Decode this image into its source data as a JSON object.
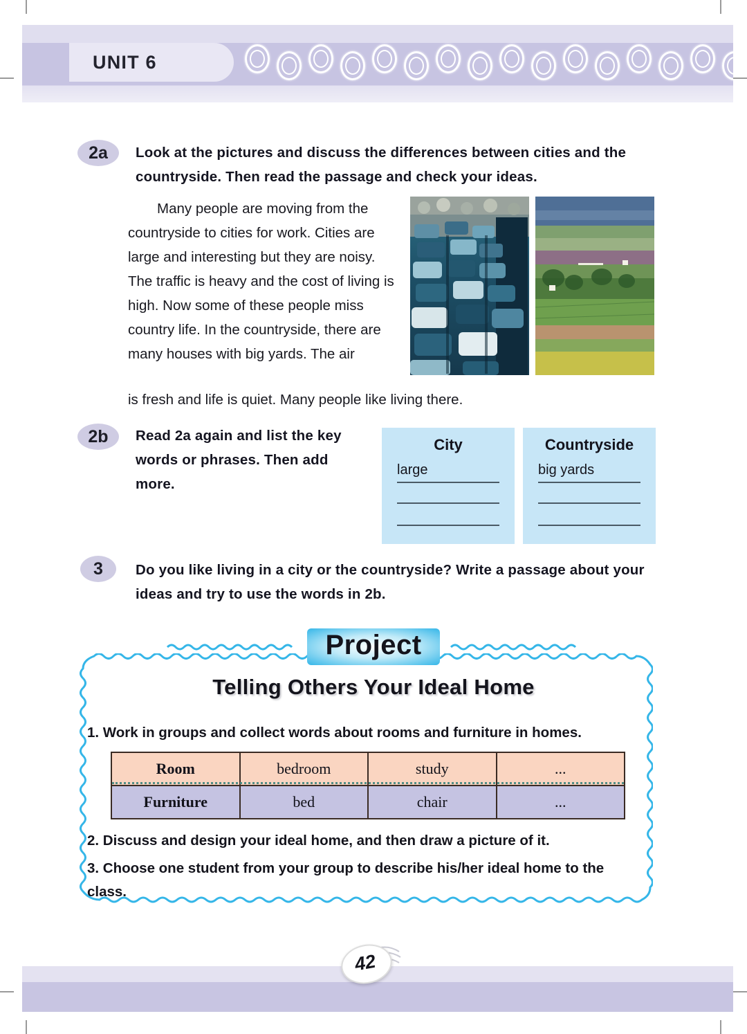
{
  "header": {
    "unit_label": "UNIT 6",
    "ring_count": 16,
    "band_color": "#c7c4e2",
    "tab_color": "#e9e7f4"
  },
  "sections": {
    "two_a": {
      "badge": "2a",
      "instruction": "Look at the pictures and discuss the differences between cities and the countryside. Then read the passage and check your ideas.",
      "passage": "Many people are moving from the countryside to cities for work. Cities are large and interesting but they are noisy. The traffic is heavy and the cost of living is high. Now some of these people miss country life. In the countryside, there are many houses with big yards. The air",
      "passage_last_line": "is fresh and life is quiet. Many people like living there.",
      "images": [
        {
          "name": "city-traffic-photo",
          "alt": "Heavy traffic jam with many cars on a city road"
        },
        {
          "name": "countryside-photo",
          "alt": "Green countryside fields and farmland"
        }
      ]
    },
    "two_b": {
      "badge": "2b",
      "instruction": "Read 2a again and list the key words or phrases. Then add more.",
      "columns": [
        {
          "title": "City",
          "first_word": "large",
          "blank_lines": 3
        },
        {
          "title": "Countryside",
          "first_word": "big yards",
          "blank_lines": 3
        }
      ],
      "box_color": "#c7e6f7"
    },
    "three": {
      "badge": "3",
      "instruction": "Do you like living in a city or the countryside? Write a passage about your ideas and try to use the words in 2b."
    }
  },
  "project": {
    "chip_label": "Project",
    "heading": "Telling Others Your Ideal Home",
    "border_color": "#35b6e8",
    "items": [
      "1. Work in groups and collect words about rooms and furniture in homes.",
      "2. Discuss and design your ideal home, and then draw a picture of it.",
      "3. Choose one student from your group to describe his/her ideal home to the class."
    ],
    "table": {
      "rows": [
        {
          "header": "Room",
          "cells": [
            "bedroom",
            "study",
            "..."
          ],
          "color": "#fad5c1"
        },
        {
          "header": "Furniture",
          "cells": [
            "bed",
            "chair",
            "..."
          ],
          "color": "#c5c3e2"
        }
      ]
    }
  },
  "footer": {
    "page_number": "42"
  }
}
